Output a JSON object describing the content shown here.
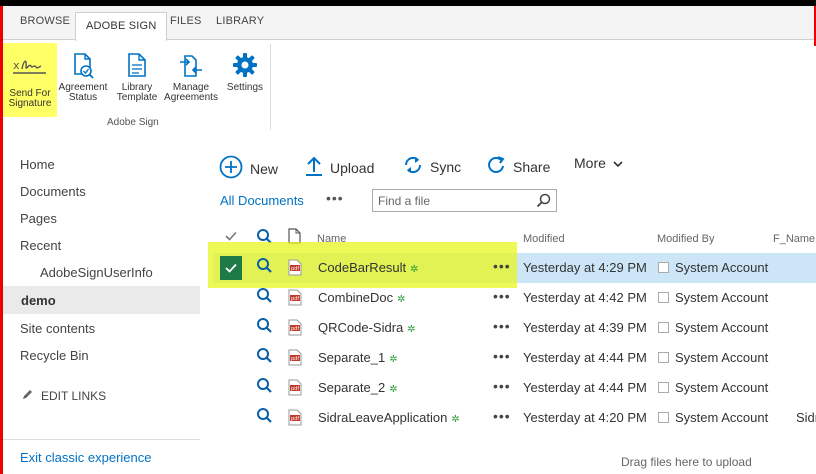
{
  "ribbon": {
    "tabs": [
      "BROWSE",
      "ADOBE SIGN",
      "FILES",
      "LIBRARY"
    ],
    "buttons": [
      {
        "label1": "Send For",
        "label2": "Signature",
        "icon": "signature-icon"
      },
      {
        "label1": "Agreement",
        "label2": "Status",
        "icon": "agreement-status-icon"
      },
      {
        "label1": "Library",
        "label2": "Template",
        "icon": "library-template-icon"
      },
      {
        "label1": "Manage",
        "label2": "Agreements",
        "icon": "manage-agreements-icon"
      },
      {
        "label1": "Settings",
        "label2": "",
        "icon": "gear-icon"
      }
    ],
    "group_label": "Adobe Sign"
  },
  "nav": {
    "items": [
      "Home",
      "Documents",
      "Pages",
      "Recent",
      "AdobeSignUserInfo",
      "demo",
      "Site contents",
      "Recycle Bin"
    ],
    "edit_links": "EDIT LINKS",
    "exit": "Exit classic experience"
  },
  "commands": {
    "new": "New",
    "upload": "Upload",
    "sync": "Sync",
    "share": "Share",
    "more": "More",
    "view": "All Documents",
    "view_more": "•••",
    "search_placeholder": "Find a file"
  },
  "list": {
    "headers": {
      "name": "Name",
      "modified": "Modified",
      "modified_by": "Modified By",
      "f_name": "F_Name"
    },
    "rows": [
      {
        "name": "CodeBarResult",
        "modified": "Yesterday at 4:29 PM",
        "modified_by": "System Account",
        "f_name": "",
        "selected": true
      },
      {
        "name": "CombineDoc",
        "modified": "Yesterday at 4:42 PM",
        "modified_by": "System Account",
        "f_name": ""
      },
      {
        "name": "QRCode-Sidra",
        "modified": "Yesterday at 4:39 PM",
        "modified_by": "System Account",
        "f_name": ""
      },
      {
        "name": "Separate_1",
        "modified": "Yesterday at 4:44 PM",
        "modified_by": "System Account",
        "f_name": ""
      },
      {
        "name": "Separate_2",
        "modified": "Yesterday at 4:44 PM",
        "modified_by": "System Account",
        "f_name": ""
      },
      {
        "name": "SidraLeaveApplication",
        "modified": "Yesterday at 4:20 PM",
        "modified_by": "System Account",
        "f_name": "Sidra As"
      }
    ],
    "drag_message": "Drag files here to upload"
  },
  "colors": {
    "accent": "#0072c6",
    "highlight": "#ffff66",
    "selected_row": "#cde6f7",
    "check": "#1e7a46"
  }
}
